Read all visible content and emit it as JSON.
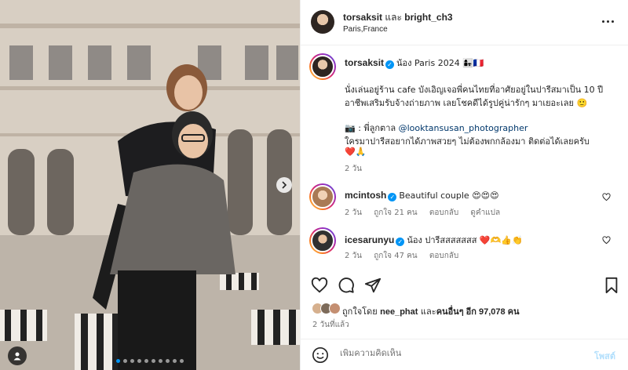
{
  "header": {
    "user1": "torsaksit",
    "conjunction": "และ",
    "user2": "bright_ch3",
    "location": "Paris,France"
  },
  "caption": {
    "username": "torsaksit",
    "title_line": "น้อง Paris 2024 👩‍👧🇫🇷",
    "line1": "นั่งเล่นอยู่ร้าน cafe บังเอิญเจอพี่คนไทยที่อาศัยอยู่ในปารีสมาเป็น 10 ปี",
    "line2": "อาชีพเสริมรับจ้างถ่ายภาพ เลยโชคดีได้รูปคู่น่ารักๆ มาเยอะเลย 🙂",
    "line3_prefix": "📷 : พี่ลูกตาล ",
    "line3_link": "@looktansusan_photographer",
    "line4": "ใครมาปารีสอยากได้ภาพสวยๆ ไม่ต้องพกกล้องมา ติดต่อได้เลยครับ",
    "line5": "❤️🙏",
    "age": "2 วัน"
  },
  "comments": [
    {
      "username": "mcintosh",
      "verified": true,
      "text": "Beautiful couple 😍😍😍",
      "age": "2 วัน",
      "likes": "ถูกใจ 21 คน",
      "reply": "ตอบกลับ",
      "translate": "ดูคำแปล",
      "avatar_color": "#c9a27a"
    },
    {
      "username": "icesarunyu",
      "verified": true,
      "text": "น้อง ปารีสสสสสสส ❤️🫶👍👏",
      "age": "2 วัน",
      "likes": "ถูกใจ 47 คน",
      "reply": "ตอบกลับ",
      "avatar_color": "#3b3b3b"
    }
  ],
  "likes": {
    "prefix": "ถูกใจโดย ",
    "user": "nee_phat",
    "middle": " และ",
    "others": "คนอื่นๆ อีก 97,078 คน"
  },
  "time_ago": "2 วันที่แล้ว",
  "comment_input": {
    "placeholder": "เพิ่มความคิดเห็น",
    "post_label": "โพสต์"
  },
  "icons": {
    "like": "heart-icon",
    "comment": "comment-icon",
    "share": "share-icon",
    "save": "bookmark-icon",
    "more": "more-icon",
    "emoji": "emoji-icon",
    "next": "chevron-right-icon",
    "user_tag": "person-icon"
  },
  "colors": {
    "accent": "#0095f6",
    "link": "#00376b",
    "muted": "#737373",
    "like_red": "#ed4956"
  },
  "carousel": {
    "count": 10,
    "active_index": 0
  }
}
